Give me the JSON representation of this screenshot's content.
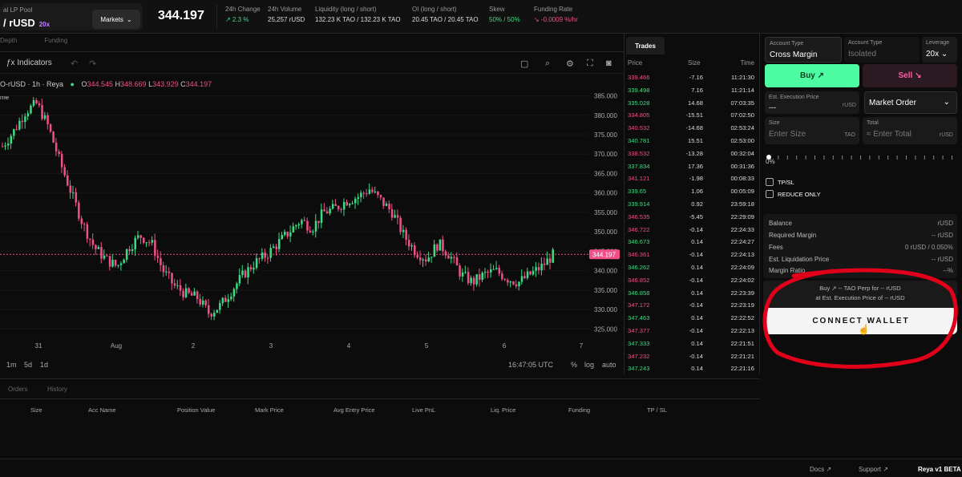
{
  "topbar": {
    "pool_label": "al LP Pool",
    "pair": "/ rUSD",
    "leverage": "20x",
    "markets_label": "Markets",
    "price": "344.197",
    "stats": [
      {
        "label": "24h Change",
        "value": "↗ 2.3 %"
      },
      {
        "label": "24h Volume",
        "value": "25,257 rUSD"
      },
      {
        "label": "Liquidity (long / short)",
        "value": "132.23 K TAO / 132.23 K TAO"
      },
      {
        "label": "OI (long / short)",
        "value": "20.45 TAO / 20.45 TAO"
      },
      {
        "label": "Skew",
        "value": "50% / 50%"
      },
      {
        "label": "Funding Rate",
        "value": "↘ -0.0009 %/hr"
      }
    ]
  },
  "chart_tabs": [
    "Depth",
    "Funding"
  ],
  "chart_toolbar": {
    "indicators_label": "Indicators"
  },
  "ohlc": {
    "title": "O-rUSD · 1h · Reya",
    "o": "344.545",
    "h": "348.669",
    "l": "343.929",
    "c": "344.197",
    "side_label": "me"
  },
  "chart_data": {
    "type": "candlestick",
    "ylim": [
      323,
      388
    ],
    "yticks": [
      "385.000",
      "380.000",
      "375.000",
      "370.000",
      "365.000",
      "360.000",
      "355.000",
      "350.000",
      "345.000",
      "340.000",
      "335.000",
      "330.000",
      "325.000"
    ],
    "xticks": [
      "31",
      "Aug",
      "2",
      "3",
      "4",
      "5",
      "6",
      "7"
    ],
    "last_price": "344.197",
    "close_path": [
      372,
      376,
      381,
      383,
      377,
      368,
      360,
      352,
      346,
      343,
      341,
      346,
      349,
      347,
      340,
      336,
      334,
      333,
      329,
      331,
      335,
      339,
      342,
      344,
      347,
      350,
      353,
      351,
      355,
      356,
      358,
      359,
      361,
      358,
      355,
      349,
      345,
      343,
      347,
      344,
      339,
      337,
      339,
      340,
      338,
      337,
      339,
      341,
      344
    ]
  },
  "chart_bottom": {
    "timeframes": [
      "1m",
      "5d",
      "1d"
    ],
    "time": "16:47:05 UTC",
    "pct": "%",
    "log": "log",
    "auto": "auto"
  },
  "trades": {
    "tab": "Trades",
    "headers": {
      "price": "Price",
      "size": "Size",
      "time": "Time"
    },
    "rows": [
      {
        "p": "339.466",
        "s": "-7.16",
        "t": "11:21:30",
        "side": "sell"
      },
      {
        "p": "339.498",
        "s": "7.16",
        "t": "11:21:14",
        "side": "buy"
      },
      {
        "p": "335.028",
        "s": "14.68",
        "t": "07:03:35",
        "side": "buy"
      },
      {
        "p": "334.805",
        "s": "-15.51",
        "t": "07:02:50",
        "side": "sell"
      },
      {
        "p": "340.532",
        "s": "-14.68",
        "t": "02:53:24",
        "side": "sell"
      },
      {
        "p": "340.781",
        "s": "15.51",
        "t": "02:53:00",
        "side": "buy"
      },
      {
        "p": "338.532",
        "s": "-13.28",
        "t": "00:32:04",
        "side": "sell"
      },
      {
        "p": "337.834",
        "s": "17.36",
        "t": "00:31:36",
        "side": "buy"
      },
      {
        "p": "341.121",
        "s": "-1.98",
        "t": "00:08:33",
        "side": "sell"
      },
      {
        "p": "339.65",
        "s": "1.06",
        "t": "00:05:09",
        "side": "buy"
      },
      {
        "p": "339.914",
        "s": "0.92",
        "t": "23:59:18",
        "side": "buy"
      },
      {
        "p": "346.535",
        "s": "-5.45",
        "t": "22:29:09",
        "side": "sell"
      },
      {
        "p": "346.722",
        "s": "-0.14",
        "t": "22:24:33",
        "side": "sell"
      },
      {
        "p": "346.673",
        "s": "0.14",
        "t": "22:24:27",
        "side": "buy"
      },
      {
        "p": "346.361",
        "s": "-0.14",
        "t": "22:24:13",
        "side": "sell"
      },
      {
        "p": "346.262",
        "s": "0.14",
        "t": "22:24:09",
        "side": "buy"
      },
      {
        "p": "346.852",
        "s": "-0.14",
        "t": "22:24:02",
        "side": "sell"
      },
      {
        "p": "346.858",
        "s": "0.14",
        "t": "22:23:39",
        "side": "buy"
      },
      {
        "p": "347.172",
        "s": "-0.14",
        "t": "22:23:19",
        "side": "sell"
      },
      {
        "p": "347.463",
        "s": "0.14",
        "t": "22:22:52",
        "side": "buy"
      },
      {
        "p": "347.377",
        "s": "-0.14",
        "t": "22:22:13",
        "side": "sell"
      },
      {
        "p": "347.333",
        "s": "0.14",
        "t": "22:21:51",
        "side": "buy"
      },
      {
        "p": "347.232",
        "s": "-0.14",
        "t": "22:21:21",
        "side": "sell"
      },
      {
        "p": "347.243",
        "s": "0.14",
        "t": "22:21:16",
        "side": "buy"
      }
    ]
  },
  "orders": {
    "tabs": [
      "Orders",
      "History"
    ],
    "columns": [
      "Size",
      "Acc Name",
      "Position Value",
      "Mark Price",
      "Avg Entry Price",
      "Live PnL",
      "Liq. Price",
      "Funding",
      "TP / SL"
    ]
  },
  "order_form": {
    "account_type_label": "Account Type",
    "account_type_value": "Cross Margin",
    "account_type2_label": "Account Type",
    "account_type2_value": "Isolated",
    "leverage_label": "Leverage",
    "leverage_value": "20x ⌄",
    "buy_label": "Buy ↗",
    "sell_label": "Sell ↘",
    "exec_price_label": "Est. Execution Price",
    "exec_price_value": "---",
    "exec_price_unit": "rUSD",
    "order_type": "Market Order",
    "size_label": "Size",
    "size_placeholder": "Enter Size",
    "size_unit": "TAO",
    "total_label": "Total",
    "total_placeholder": "≈ Enter Total",
    "total_unit": "rUSD",
    "slider_pct": "0%",
    "tpsl_label": "TP/SL",
    "reduce_label": "REDUCE ONLY",
    "info": [
      {
        "label": "Balance",
        "value": "rUSD"
      },
      {
        "label": "Required Margin",
        "value": "-- rUSD"
      },
      {
        "label": "Fees",
        "value": "0 rUSD / 0.050%"
      },
      {
        "label": "Est. Liquidation Price",
        "value": "-- rUSD"
      },
      {
        "label": "Margin Ratio",
        "value": "--%"
      }
    ],
    "summary_line1": "Buy ↗ -- TAO Perp for -- rUSD",
    "summary_line2": "at Est. Execution Price of -- rUSD",
    "connect_label": "CONNECT WALLET"
  },
  "footer": {
    "docs": "Docs ↗",
    "support": "Support ↗",
    "version": "Reya v1 BETA"
  },
  "colors": {
    "buy": "#3ddc84",
    "sell": "#f0508a",
    "accent": "#4dfca2",
    "annotation": "#e0001a"
  }
}
